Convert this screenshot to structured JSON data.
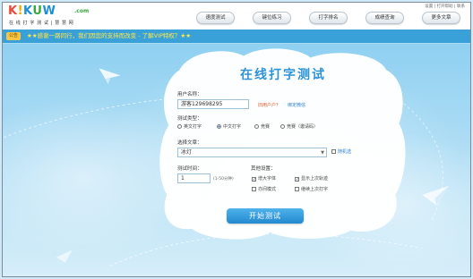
{
  "header": {
    "logo": {
      "k1": "K",
      "i": "!",
      "k2": "K",
      "u": "U",
      "w": "W",
      "domain": ".com",
      "subtitle": "在 线 打 字 测 试  |  慧 慧 网"
    },
    "helper_text": "设置 | 打开帮助 | 联系",
    "nav": [
      "速度测试",
      "键位练习",
      "打字排名",
      "成绩查询",
      "更多文章"
    ]
  },
  "notice": {
    "badge": "公告",
    "text": "★★感谢一路同行，我们因您的支持而改变 - 了解VIP特权？★★"
  },
  "panel": {
    "title": "在线打字测试",
    "username_label": "用户名称：",
    "username_value": "游客129698295",
    "old_user_link": "旧用户户？",
    "bind_wechat_link": "绑定微信",
    "test_type_label": "测试类型：",
    "test_types": [
      {
        "label": "英文打字",
        "checked": false
      },
      {
        "label": "中文打字",
        "checked": true
      },
      {
        "label": "竞赛",
        "checked": false
      },
      {
        "label": "竞赛（邀请码）",
        "checked": false
      }
    ],
    "article_label": "选择文章：",
    "article_value": "冰灯",
    "random_label": "随机选",
    "time_label": "测试时间：",
    "time_value": "1",
    "time_hint": "(1-50分钟)",
    "other_label": "其他设置：",
    "options": [
      {
        "label": "增大字体",
        "checked": true
      },
      {
        "label": "显示上次轨迹",
        "checked": true
      },
      {
        "label": "亦间模式",
        "checked": false
      },
      {
        "label": "继续上次打字",
        "checked": false
      }
    ],
    "start_button": "开始测试"
  }
}
